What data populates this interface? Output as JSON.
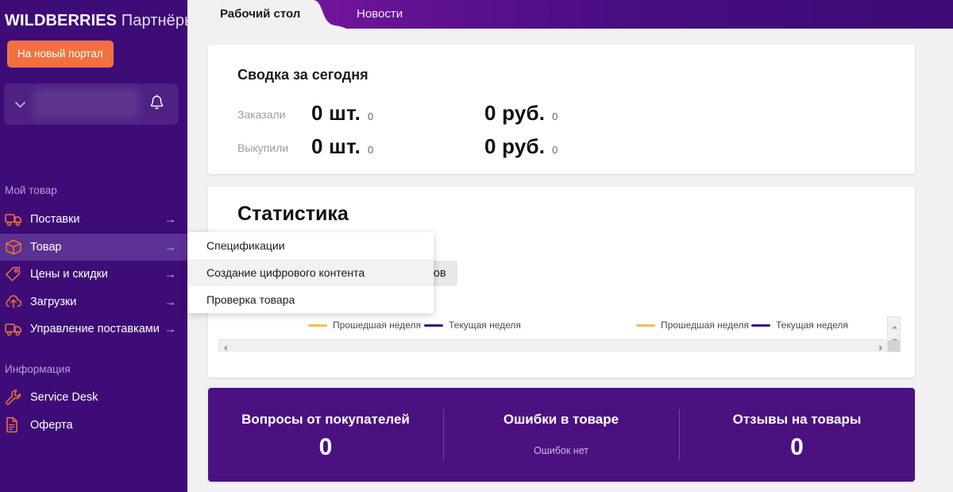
{
  "brand": {
    "name_bold": "WILDBERRIES",
    "name_light": "Партнёры"
  },
  "sidebar": {
    "portal_button": "На новый портал",
    "account": {
      "chevron_icon": "chevron-down-icon",
      "bell_icon": "bell-icon"
    },
    "sections": [
      {
        "title": "Мой товар",
        "items": [
          {
            "label": "Поставки",
            "icon": "truck-icon",
            "arrow": "→",
            "active": false
          },
          {
            "label": "Товар",
            "icon": "box-icon",
            "arrow": "→",
            "active": true
          },
          {
            "label": "Цены и скидки",
            "icon": "tag-icon",
            "arrow": "→",
            "active": false
          },
          {
            "label": "Загрузки",
            "icon": "cloud-upload-icon",
            "arrow": "→",
            "active": false
          },
          {
            "label": "Управление поставками",
            "icon": "truck-icon",
            "arrow": "→",
            "active": false
          }
        ]
      },
      {
        "title": "Информация",
        "items": [
          {
            "label": "Service Desk",
            "icon": "wrench-icon",
            "arrow": "",
            "active": false
          },
          {
            "label": "Оферта",
            "icon": "document-icon",
            "arrow": "",
            "active": false
          }
        ]
      }
    ]
  },
  "tabs": [
    {
      "label": "Рабочий стол",
      "active": true
    },
    {
      "label": "Новости",
      "active": false
    }
  ],
  "summary": {
    "title": "Сводка за сегодня",
    "rows": [
      {
        "label": "Заказали",
        "qty_value": "0 шт.",
        "qty_sub": "0",
        "money_value": "0 руб.",
        "money_sub": "0"
      },
      {
        "label": "Выкупили",
        "qty_value": "0 шт.",
        "qty_sub": "0",
        "money_value": "0 руб.",
        "money_sub": "0"
      }
    ]
  },
  "statistics": {
    "title": "Статистика",
    "segment_tab": "ность товаров",
    "legend_left": [
      {
        "label": "Прошедшая неделя",
        "color": "#f7bf52"
      },
      {
        "label": "Текущая неделя",
        "color": "#3d0b77"
      }
    ],
    "legend_right": [
      {
        "label": "Прошедшая неделя",
        "color": "#f7bf52"
      },
      {
        "label": "Текущая неделя",
        "color": "#3d0b77"
      }
    ],
    "hscroll_left_icon": "scroll-left-arrow-icon",
    "hscroll_right_icon": "scroll-right-arrow-icon",
    "vscroll_up_icon": "scroll-up-arrow-icon",
    "vscroll_down_icon": "scroll-down-arrow-icon"
  },
  "bottom_stats": [
    {
      "heading": "Вопросы от покупателей",
      "value": "0",
      "note": ""
    },
    {
      "heading": "Ошибки в товаре",
      "value": "",
      "note": "Ошибок нет"
    },
    {
      "heading": "Отзывы на товары",
      "value": "0",
      "note": ""
    }
  ],
  "dropdown": {
    "items": [
      {
        "label": "Спецификации",
        "highlighted": false
      },
      {
        "label": "Создание цифрового контента",
        "highlighted": true
      },
      {
        "label": "Проверка товара",
        "highlighted": false
      }
    ]
  },
  "colors": {
    "sidebar_bg": "#3d0c77",
    "sidebar_active": "#5b3193",
    "accent_orange": "#f2713f",
    "purple_card": "#4b1180",
    "tabbar_gradient_start": "#8e17ad",
    "tabbar_gradient_end": "#3c0b76",
    "page_bg": "#f1f1f1",
    "legend_yellow": "#f7bf52",
    "legend_purple": "#3d0b77"
  }
}
